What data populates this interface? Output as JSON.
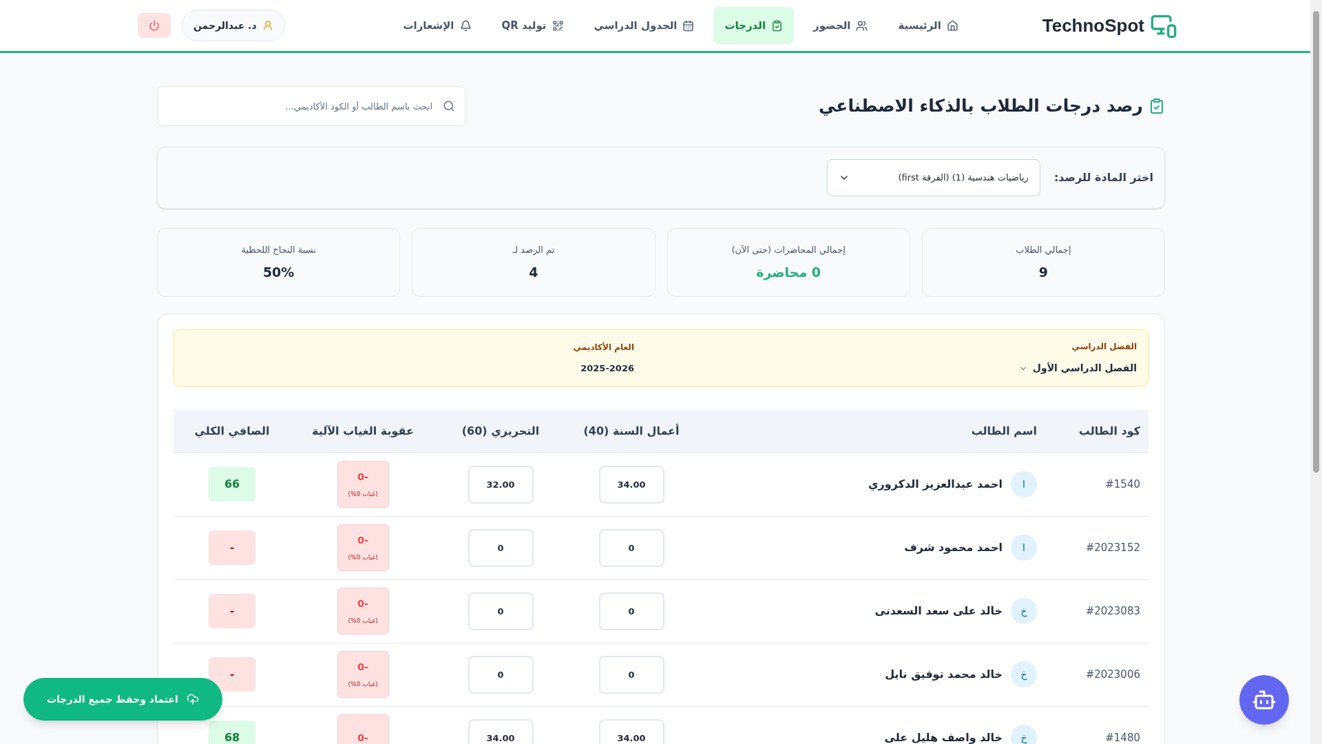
{
  "header": {
    "logo": "TechnoSpot",
    "nav": [
      {
        "label": "الرئيسية",
        "kind": "home",
        "selected": false
      },
      {
        "label": "الحضور",
        "kind": "users",
        "selected": false
      },
      {
        "label": "الدرجات",
        "kind": "clipboard",
        "selected": true
      },
      {
        "label": "الجدول الدراسي",
        "kind": "calendar",
        "selected": false
      },
      {
        "label": "توليد QR",
        "kind": "qr",
        "selected": false
      },
      {
        "label": "الإشعارات",
        "kind": "bell",
        "selected": false
      }
    ],
    "user": "د. عبدالرحمن"
  },
  "page": {
    "title": "رصد درجات الطلاب بالذكاء الاصطناعي",
    "search": {
      "placeholder": "ابحث باسم الطالب أو الكود الأكاديمي..."
    }
  },
  "subject": {
    "label": "اختر المادة للرصد:",
    "value": "رياضيات هندسية (1) (الفرقة first)"
  },
  "stats": [
    {
      "label": "إجمالي الطلاب",
      "value": "9",
      "kind": "plain"
    },
    {
      "label": "إجمالي المحاضرات (حتى الآن)",
      "value": "0 محاضرة",
      "kind": "accent"
    },
    {
      "label": "تم الرصد لـ",
      "value": "4",
      "kind": "plain"
    },
    {
      "label": "نسبة النجاح اللحظية",
      "value": "50%",
      "kind": "plain"
    }
  ],
  "term": {
    "semester_label": "الفصل الدراسي",
    "semester": "الفصل الدراسي الأول",
    "year_label": "العام الأكاديمي",
    "year": "2025-2026"
  },
  "table": {
    "columns": [
      "كود الطالب",
      "اسم الطالب",
      "أعمال السنة (40)",
      "التحريري (60)",
      "عقوبة الغياب الآلية",
      "الصافي الكلي"
    ],
    "rows": [
      {
        "code": "#1540",
        "initial": "ا",
        "name": "احمد عبدالعزيز الدكروري",
        "coursework": "34.00",
        "written": "32.00",
        "penalty": "-0",
        "penalty_note": "(غياب 0%)",
        "net": "66",
        "kind": "pass"
      },
      {
        "code": "#2023152",
        "initial": "ا",
        "name": "احمد محمود شرف",
        "coursework": "0",
        "written": "0",
        "penalty": "-0",
        "penalty_note": "(غياب 0%)",
        "net": "-",
        "kind": "fail"
      },
      {
        "code": "#2023083",
        "initial": "خ",
        "name": "خالد على سعد السعدنى",
        "coursework": "0",
        "written": "0",
        "penalty": "-0",
        "penalty_note": "(غياب 0%)",
        "net": "-",
        "kind": "fail"
      },
      {
        "code": "#2023006",
        "initial": "خ",
        "name": "خالد محمد توفيق نايل",
        "coursework": "0",
        "written": "0",
        "penalty": "-0",
        "penalty_note": "(غياب 0%)",
        "net": "-",
        "kind": "fail"
      },
      {
        "code": "#1480",
        "initial": "خ",
        "name": "خالد واصف هليل على",
        "coursework": "34.00",
        "written": "34.00",
        "penalty": "-0",
        "net": "68",
        "kind": "pass"
      }
    ]
  },
  "save_button": "اعتماد وحفظ جميع الدرجات"
}
